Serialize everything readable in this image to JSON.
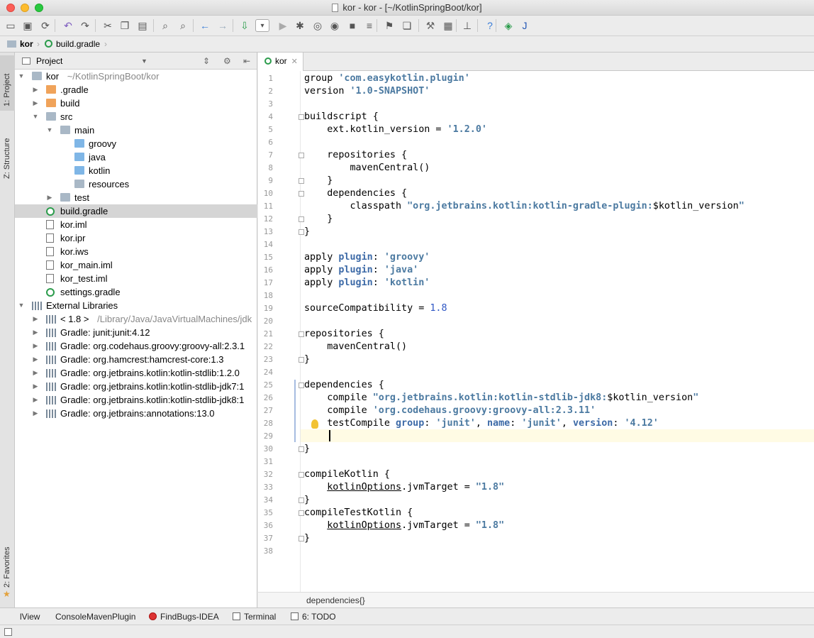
{
  "window": {
    "title": "kor - kor - [~/KotlinSpringBoot/kor]"
  },
  "toolbar": {
    "buttons": [
      "open-icon",
      "save-icon",
      "sync-icon",
      "undo-icon",
      "redo-icon",
      "cut-icon",
      "copy-icon",
      "paste-icon",
      "find-icon",
      "replace-icon",
      "back-icon",
      "forward-icon",
      "build-icon",
      "run-config-dropdown",
      "run-icon",
      "debug-icon",
      "coverage-icon",
      "profile-icon",
      "stop-icon",
      "attach-icon",
      "update-icon",
      "vcs-icon",
      "settings-icon",
      "project-structure-icon",
      "sdk-icon",
      "help-icon",
      "gradle-icon",
      "jetbrains-icon"
    ]
  },
  "navbar": {
    "project": "kor",
    "file": "build.gradle"
  },
  "left_tools": {
    "project_tab": "1: Project",
    "structure_tab": "Z: Structure",
    "favorites_tab": "2: Favorites"
  },
  "project_panel": {
    "header": "Project",
    "tree": [
      {
        "label": "kor",
        "extra": "~/KotlinSpringBoot/kor",
        "icon": "folder",
        "arrow": "down",
        "level": 0
      },
      {
        "label": ".gradle",
        "icon": "folder-orange",
        "arrow": "right",
        "level": 1
      },
      {
        "label": "build",
        "icon": "folder-orange",
        "arrow": "right",
        "level": 1
      },
      {
        "label": "src",
        "icon": "folder",
        "arrow": "down",
        "level": 1
      },
      {
        "label": "main",
        "icon": "folder",
        "arrow": "down",
        "level": 2
      },
      {
        "label": "groovy",
        "icon": "folder-blue",
        "arrow": "",
        "level": 3
      },
      {
        "label": "java",
        "icon": "folder-blue",
        "arrow": "",
        "level": 3
      },
      {
        "label": "kotlin",
        "icon": "folder-blue",
        "arrow": "",
        "level": 3
      },
      {
        "label": "resources",
        "icon": "folder",
        "arrow": "",
        "level": 3
      },
      {
        "label": "test",
        "icon": "folder",
        "arrow": "right",
        "level": 2
      },
      {
        "label": "build.gradle",
        "icon": "gradle",
        "arrow": "",
        "level": 1,
        "selected": true
      },
      {
        "label": "kor.iml",
        "icon": "file",
        "arrow": "",
        "level": 1
      },
      {
        "label": "kor.ipr",
        "icon": "file",
        "arrow": "",
        "level": 1
      },
      {
        "label": "kor.iws",
        "icon": "file",
        "arrow": "",
        "level": 1
      },
      {
        "label": "kor_main.iml",
        "icon": "file",
        "arrow": "",
        "level": 1
      },
      {
        "label": "kor_test.iml",
        "icon": "file",
        "arrow": "",
        "level": 1
      },
      {
        "label": "settings.gradle",
        "icon": "gradle",
        "arrow": "",
        "level": 1
      },
      {
        "label": "External Libraries",
        "icon": "lib",
        "arrow": "down",
        "level": 0
      },
      {
        "label": "< 1.8 >",
        "extra": "/Library/Java/JavaVirtualMachines/jdk",
        "icon": "lib",
        "arrow": "right",
        "level": 1
      },
      {
        "label": "Gradle: junit:junit:4.12",
        "icon": "lib",
        "arrow": "right",
        "level": 1
      },
      {
        "label": "Gradle: org.codehaus.groovy:groovy-all:2.3.1",
        "icon": "lib",
        "arrow": "right",
        "level": 1
      },
      {
        "label": "Gradle: org.hamcrest:hamcrest-core:1.3",
        "icon": "lib",
        "arrow": "right",
        "level": 1
      },
      {
        "label": "Gradle: org.jetbrains.kotlin:kotlin-stdlib:1.2.0",
        "icon": "lib",
        "arrow": "right",
        "level": 1
      },
      {
        "label": "Gradle: org.jetbrains.kotlin:kotlin-stdlib-jdk7:1",
        "icon": "lib",
        "arrow": "right",
        "level": 1
      },
      {
        "label": "Gradle: org.jetbrains.kotlin:kotlin-stdlib-jdk8:1",
        "icon": "lib",
        "arrow": "right",
        "level": 1
      },
      {
        "label": "Gradle: org.jetbrains:annotations:13.0",
        "icon": "lib",
        "arrow": "right",
        "level": 1
      }
    ]
  },
  "editor": {
    "tab": "kor",
    "breadcrumb": "dependencies{}",
    "line_count": 38,
    "lines": [
      [
        [
          "p",
          "group "
        ],
        [
          "str",
          "'com.easykotlin.plugin'"
        ]
      ],
      [
        [
          "p",
          "version "
        ],
        [
          "str",
          "'1.0-SNAPSHOT'"
        ]
      ],
      [],
      [
        [
          "p",
          "buildscript {"
        ]
      ],
      [
        [
          "p",
          "    ext.kotlin_version = "
        ],
        [
          "str",
          "'1.2.0'"
        ]
      ],
      [],
      [
        [
          "p",
          "    repositories {"
        ]
      ],
      [
        [
          "p",
          "        mavenCentral()"
        ]
      ],
      [
        [
          "p",
          "    }"
        ]
      ],
      [
        [
          "p",
          "    dependencies {"
        ]
      ],
      [
        [
          "p",
          "        classpath "
        ],
        [
          "str",
          "\"org.jetbrains.kotlin:kotlin-gradle-plugin:"
        ],
        [
          "p",
          "$kotlin_version"
        ],
        [
          "str",
          "\""
        ]
      ],
      [
        [
          "p",
          "    }"
        ]
      ],
      [
        [
          "p",
          "}"
        ]
      ],
      [],
      [
        [
          "p",
          "apply "
        ],
        [
          "kw",
          "plugin"
        ],
        [
          "p",
          ": "
        ],
        [
          "str",
          "'groovy'"
        ]
      ],
      [
        [
          "p",
          "apply "
        ],
        [
          "kw",
          "plugin"
        ],
        [
          "p",
          ": "
        ],
        [
          "str",
          "'java'"
        ]
      ],
      [
        [
          "p",
          "apply "
        ],
        [
          "kw",
          "plugin"
        ],
        [
          "p",
          ": "
        ],
        [
          "str",
          "'kotlin'"
        ]
      ],
      [],
      [
        [
          "p",
          "sourceCompatibility = "
        ],
        [
          "n",
          "1.8"
        ]
      ],
      [],
      [
        [
          "p",
          "repositories {"
        ]
      ],
      [
        [
          "p",
          "    mavenCentral()"
        ]
      ],
      [
        [
          "p",
          "}"
        ]
      ],
      [],
      [
        [
          "p",
          "dependencies {"
        ]
      ],
      [
        [
          "p",
          "    compile "
        ],
        [
          "str",
          "\"org.jetbrains.kotlin:kotlin-stdlib-jdk8:"
        ],
        [
          "p",
          "$kotlin_version"
        ],
        [
          "str",
          "\""
        ]
      ],
      [
        [
          "p",
          "    compile "
        ],
        [
          "str",
          "'org.codehaus.groovy:groovy-all:2.3.11'"
        ]
      ],
      [
        [
          "p",
          "    testCompile "
        ],
        [
          "kw",
          "group"
        ],
        [
          "p",
          ": "
        ],
        [
          "str",
          "'junit'"
        ],
        [
          "p",
          ", "
        ],
        [
          "kw",
          "name"
        ],
        [
          "p",
          ": "
        ],
        [
          "str",
          "'junit'"
        ],
        [
          "p",
          ", "
        ],
        [
          "kw",
          "version"
        ],
        [
          "p",
          ": "
        ],
        [
          "str",
          "'4.12'"
        ]
      ],
      [],
      [
        [
          "p",
          "}"
        ]
      ],
      [],
      [
        [
          "p",
          "compileKotlin {"
        ]
      ],
      [
        [
          "p",
          "    "
        ],
        [
          "u",
          "kotlinOptions"
        ],
        [
          "p",
          ".jvmTarget = "
        ],
        [
          "str",
          "\"1.8\""
        ]
      ],
      [
        [
          "p",
          "}"
        ]
      ],
      [
        [
          "p",
          "compileTestKotlin {"
        ]
      ],
      [
        [
          "p",
          "    "
        ],
        [
          "u",
          "kotlinOptions"
        ],
        [
          "p",
          ".jvmTarget = "
        ],
        [
          "str",
          "\"1.8\""
        ]
      ],
      [
        [
          "p",
          "}"
        ]
      ],
      []
    ]
  },
  "bottom_tools": [
    {
      "label": "lView",
      "icon": ""
    },
    {
      "label": "ConsoleMavenPlugin",
      "icon": ""
    },
    {
      "label": "FindBugs-IDEA",
      "icon": "bug-icon"
    },
    {
      "label": "Terminal",
      "icon": "terminal-icon"
    },
    {
      "label": "6: TODO",
      "icon": "todo-icon"
    }
  ]
}
